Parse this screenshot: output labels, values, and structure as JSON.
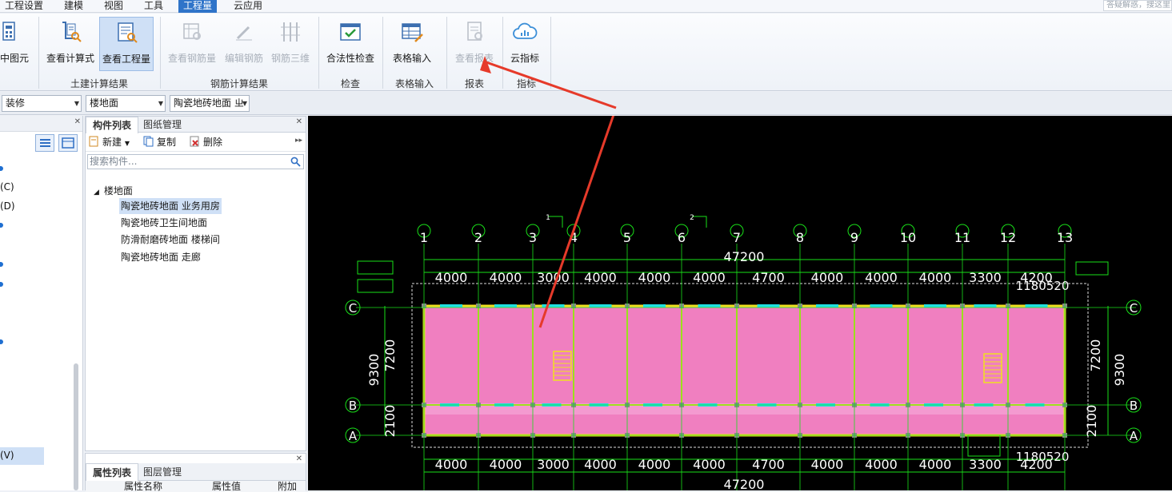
{
  "menu": {
    "items": [
      "工程设置",
      "建模",
      "视图",
      "工具",
      "工程量",
      "云应用"
    ],
    "active_index": 4,
    "search_placeholder": "答疑解惑，搜这里"
  },
  "ribbon": {
    "buttons": {
      "partial": "中图元",
      "view_formula": "查看计算式",
      "view_quantity": "查看工程量",
      "view_rebar_quantity": "查看钢筋量",
      "edit_rebar": "编辑钢筋",
      "rebar_3d": "钢筋三维",
      "legality_check": "合法性检查",
      "table_input": "表格输入",
      "view_report": "查看报表",
      "cloud_index": "云指标"
    },
    "groups": {
      "civil": "土建计算结果",
      "rebar": "钢筋计算结果",
      "check": "检查",
      "table": "表格输入",
      "report": "报表",
      "index": "指标"
    }
  },
  "filters": {
    "category": "装修",
    "subcategory": "楼地面",
    "component": "陶瓷地砖地面 ㄓ"
  },
  "left_panel": {
    "rows": [
      "(C)",
      "(D)",
      "(V)"
    ]
  },
  "component_panel": {
    "tabs": [
      "构件列表",
      "图纸管理"
    ],
    "toolbar": {
      "new": "新建",
      "copy": "复制",
      "delete": "删除"
    },
    "search_placeholder": "搜索构件...",
    "tree": {
      "root": "楼地面",
      "items": [
        "陶瓷地砖地面 业务用房",
        "陶瓷地砖卫生间地面",
        "防滑耐磨砖地面 楼梯间",
        "陶瓷地砖地面 走廊"
      ],
      "selected_index": 0
    }
  },
  "property_panel": {
    "tabs": [
      "属性列表",
      "图层管理"
    ],
    "columns": [
      "属性名称",
      "属性值",
      "附加"
    ]
  },
  "drawing": {
    "axis_numbers": [
      "1",
      "2",
      "3",
      "4",
      "5",
      "6",
      "7",
      "8",
      "9",
      "10",
      "11",
      "12",
      "13"
    ],
    "axis_letters": [
      "C",
      "B",
      "A"
    ],
    "bay_dims": [
      "4000",
      "4000",
      "3000",
      "4000",
      "4000",
      "4000",
      "4700",
      "4000",
      "4000",
      "4000",
      "3300",
      "4200"
    ],
    "total_dim": "47200",
    "side_dim": "9300",
    "side_segments": [
      "2100",
      "7200"
    ],
    "section_marks": [
      "1",
      "2"
    ],
    "top_right_dims": "1180520",
    "bottom_right_dims": "1180520",
    "colors": {
      "pink": "#f07fc0",
      "green": "#19e019",
      "yellow": "#f0e020",
      "cyan": "#20e0e0",
      "red_arrow": "#e63a2a"
    }
  }
}
